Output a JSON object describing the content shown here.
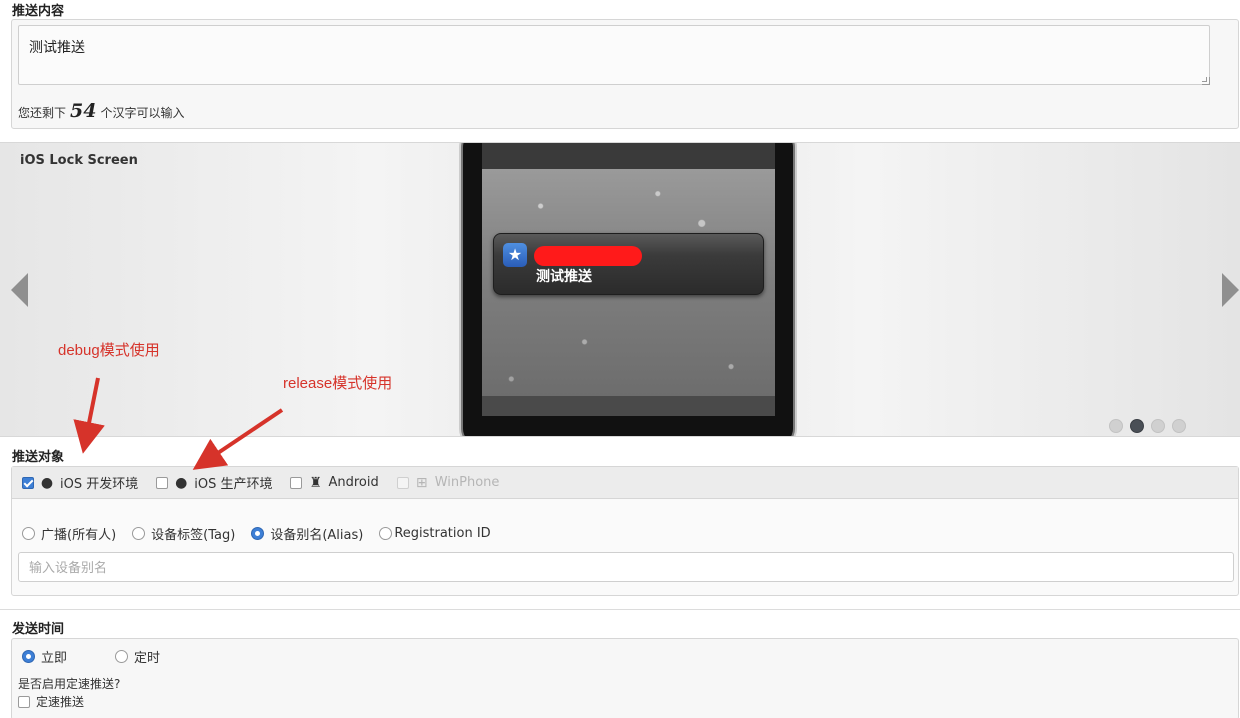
{
  "push_content": {
    "title": "推送内容",
    "message": "测试推送",
    "remaining_prefix": "您还剩下",
    "remaining_count": "54",
    "remaining_suffix": "个汉字可以输入"
  },
  "preview": {
    "title": "iOS Lock Screen",
    "notification_text": "测试推送",
    "app_icon": "star-app-icon",
    "redacted_app_name": true,
    "active_slide": 2,
    "slide_count": 4
  },
  "annotations": {
    "debug": "debug模式使用",
    "release": "release模式使用",
    "color": "#d6332a"
  },
  "target": {
    "title": "推送对象",
    "platforms": [
      {
        "label": "iOS 开发环境",
        "icon": "apple-icon",
        "checked": true,
        "disabled": false
      },
      {
        "label": "iOS 生产环境",
        "icon": "apple-icon",
        "checked": false,
        "disabled": false
      },
      {
        "label": "Android",
        "icon": "android-icon",
        "checked": false,
        "disabled": false
      },
      {
        "label": "WinPhone",
        "icon": "windows-icon",
        "checked": false,
        "disabled": true
      }
    ],
    "audience_options": [
      {
        "label": "广播(所有人)",
        "selected": false
      },
      {
        "label": "设备标签(Tag)",
        "selected": false
      },
      {
        "label": "设备别名(Alias)",
        "selected": true
      },
      {
        "label": "Registration ID",
        "selected": false
      }
    ],
    "alias_placeholder": "输入设备别名",
    "alias_value": ""
  },
  "send_time": {
    "title": "发送时间",
    "options": [
      {
        "label": "立即",
        "selected": true
      },
      {
        "label": "定时",
        "selected": false
      }
    ],
    "speed_question": "是否启用定速推送?",
    "speed_label": "定速推送",
    "speed_checked": false
  },
  "colors": {
    "accent": "#3d7fd6",
    "notification_redaction": "#ff1a1a",
    "annotation": "#d6332a"
  }
}
